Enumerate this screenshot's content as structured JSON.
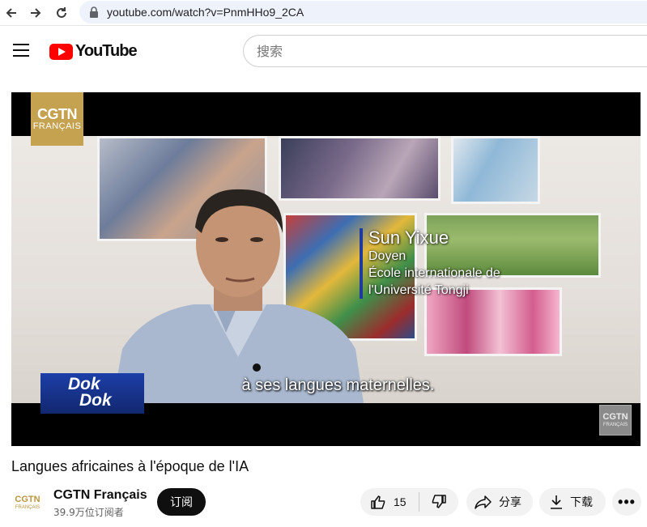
{
  "browser": {
    "url": "youtube.com/watch?v=PnmHHo9_2CA",
    "icons": [
      "arrow-left-icon",
      "arrow-right-icon",
      "reload-icon",
      "lock-icon"
    ]
  },
  "header": {
    "logo_text": "YouTube",
    "search_placeholder": "搜索",
    "icons": [
      "hamburger-menu-icon",
      "youtube-logo-icon"
    ]
  },
  "player": {
    "broadcaster_logo": {
      "main": "CGTN",
      "sub": "FRANÇAIS"
    },
    "lower_third": {
      "name": "Sun Yixue",
      "role": "Doyen",
      "org_line1": "École internationale de",
      "org_line2": "l'Université Tongji"
    },
    "subtitle": "à ses langues maternelles.",
    "show_badge": {
      "line1": "Dok",
      "line2": "Dok"
    },
    "corner_logo": {
      "main": "CGTN",
      "sub": "FRANÇAIS"
    }
  },
  "video": {
    "title": "Langues africaines à l'époque de l'IA"
  },
  "channel": {
    "avatar": {
      "main": "CGTN",
      "sub": "FRANÇAIS"
    },
    "name": "CGTN Français",
    "subscribers": "39.9万位订阅者",
    "subscribe_label": "订阅"
  },
  "actions": {
    "like_count": "15",
    "share_label": "分享",
    "download_label": "下载",
    "more_label": "•••",
    "icons": [
      "thumbs-up-icon",
      "thumbs-down-icon",
      "share-arrow-icon",
      "download-icon",
      "more-options-icon"
    ]
  },
  "colors": {
    "youtube_red": "#ff0000",
    "cgtn_gold": "#c4a24f",
    "subscribe_bg": "#0f0f0f",
    "pill_bg": "#f2f2f2",
    "dok_blue": "#1c3fa8"
  }
}
